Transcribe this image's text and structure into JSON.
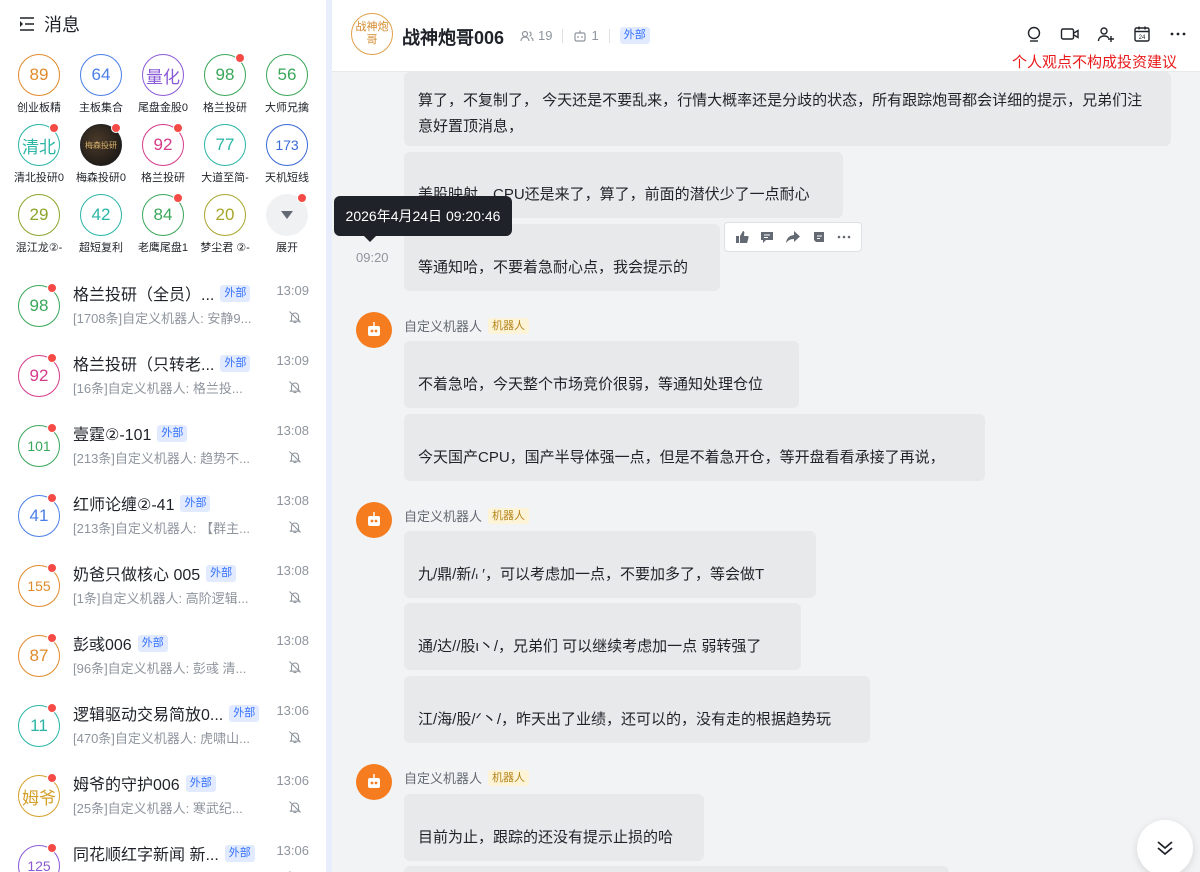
{
  "sidebar": {
    "title": "消息",
    "favorites": [
      {
        "text": "89",
        "label": "创业板精",
        "color": "#e08a2c",
        "dot": false
      },
      {
        "text": "64",
        "label": "主板集合",
        "color": "#4a7ee8",
        "dot": false
      },
      {
        "text": "量化",
        "label": "尾盘金股0",
        "color": "#8a5ad6",
        "dot": false
      },
      {
        "text": "98",
        "label": "格兰投研",
        "color": "#3aa65a",
        "dot": true
      },
      {
        "text": "56",
        "label": "大师兄擒",
        "color": "#3aa65a",
        "dot": false
      },
      {
        "text": "清北",
        "label": "清北投研0",
        "color": "#2bb5a6",
        "dot": true
      },
      {
        "text": "梅森投研",
        "label": "梅森投研0",
        "color": "#222222",
        "dot": true,
        "avatar": true
      },
      {
        "text": "92",
        "label": "格兰投研",
        "color": "#d63a8a",
        "dot": true
      },
      {
        "text": "77",
        "label": "大道至简-",
        "color": "#2bb5a6",
        "dot": false
      },
      {
        "text": "173",
        "label": "天机短线",
        "color": "#3a6ad6",
        "dot": false
      },
      {
        "text": "29",
        "label": "混江龙②-",
        "color": "#8aa62c",
        "dot": false
      },
      {
        "text": "42",
        "label": "超短复利",
        "color": "#2bb5a6",
        "dot": false
      },
      {
        "text": "84",
        "label": "老鹰尾盘1",
        "color": "#3aa65a",
        "dot": true
      },
      {
        "text": "20",
        "label": "梦尘君 ②-",
        "color": "#a6a62c",
        "dot": false
      },
      {
        "text": "",
        "label": "展开",
        "color": "#666666",
        "dot": true,
        "expand": true
      }
    ],
    "conversations": [
      {
        "avatar": "98",
        "color": "#3aa65a",
        "name": "格兰投研（全员）...",
        "ext": "外部",
        "time": "13:09",
        "preview": "[1708条]自定义机器人: 安静9..."
      },
      {
        "avatar": "92",
        "color": "#d63a8a",
        "name": "格兰投研（只转老...",
        "ext": "外部",
        "time": "13:09",
        "preview": "[16条]自定义机器人: 格兰投..."
      },
      {
        "avatar": "101",
        "color": "#3aa65a",
        "name": "壹霆②-101",
        "ext": "外部",
        "time": "13:08",
        "preview": "[213条]自定义机器人: 趋势不..."
      },
      {
        "avatar": "41",
        "color": "#4a7ee8",
        "name": "红师论缠②-41",
        "ext": "外部",
        "time": "13:08",
        "preview": "[213条]自定义机器人: 【群主..."
      },
      {
        "avatar": "155",
        "color": "#e08a2c",
        "name": "奶爸只做核心 005",
        "ext": "外部",
        "time": "13:08",
        "preview": "[1条]自定义机器人: 高阶逻辑..."
      },
      {
        "avatar": "87",
        "color": "#e08a2c",
        "name": "彭彧006",
        "ext": "外部",
        "time": "13:08",
        "preview": "[96条]自定义机器人: 彭彧 清..."
      },
      {
        "avatar": "11",
        "color": "#2bb5a6",
        "name": "逻辑驱动交易简放0...",
        "ext": "外部",
        "time": "13:06",
        "preview": "[470条]自定义机器人: 虎啸山..."
      },
      {
        "avatar": "姆爷",
        "color": "#d4a02c",
        "name": "姆爷的守护006",
        "ext": "外部",
        "time": "13:06",
        "preview": "[25条]自定义机器人: 寒武纪..."
      },
      {
        "avatar": "125",
        "color": "#8a5ad6",
        "name": "同花顺红字新闻 新...",
        "ext": "外部",
        "time": "13:06",
        "preview": ""
      }
    ]
  },
  "chat": {
    "group_avatar": "战神炮哥",
    "group_name": "战神炮哥006",
    "member_count": "19",
    "bot_count": "1",
    "ext": "外部",
    "disclaimer": "个人观点不构成投资建议",
    "messages": {
      "m1": "算了，不复制了， 今天还是不要乱来，行情大概率还是分歧的状态，所有跟踪炮哥都会详细的提示，兄弟们注意好置顶消息，",
      "m2": "美股映射，CPU还是来了，算了，前面的潜伏少了一点耐心",
      "m3": "等通知哈，不要着急耐心点，我会提示的",
      "m4": "不着急哈，今天整个市场竞价很弱，等通知处理仓位",
      "m5": "今天国产CPU，国产半导体强一点，但是不着急开仓，等开盘看看承接了再说，",
      "m6": "九/鼎/新/៲ ′，可以考虑加一点，不要加多了，等会做T",
      "m7": "通/达//股ι丶/，兄弟们 可以继续考虑加一点 弱转强了",
      "m8": "江/海/股/ᐟ丶/，昨天出了业绩，还可以的，没有走的根据趋势玩",
      "m9": "目前为止，跟踪的还没有提示止损的哈"
    },
    "sender_name": "自定义机器人",
    "bot_tag": "机器人",
    "hover_time": "09:20",
    "tooltip": "2026年4月24日 09:20:46"
  }
}
